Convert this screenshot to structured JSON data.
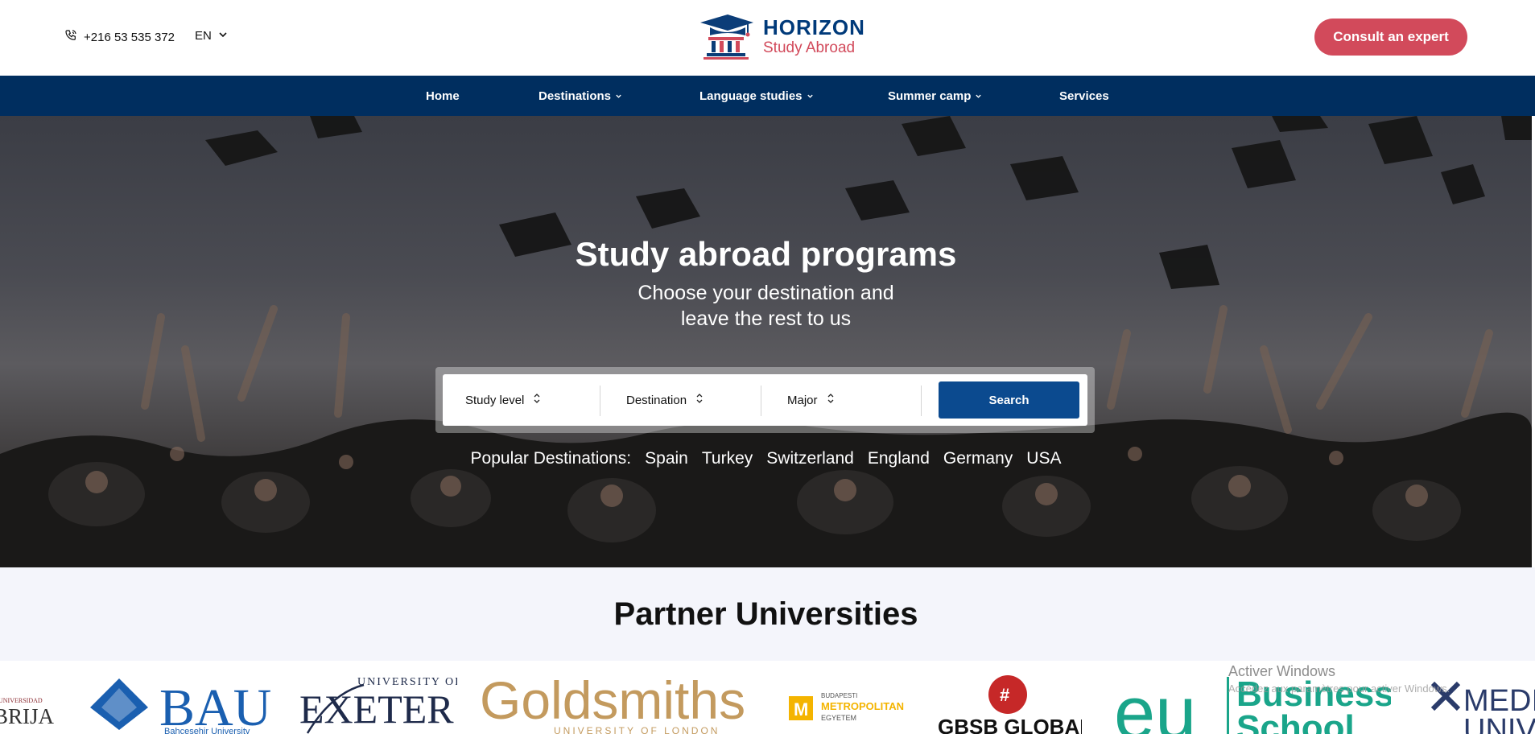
{
  "header": {
    "phone": "+216 53 535 372",
    "language": "EN",
    "logo_title": "HORIZON",
    "logo_subtitle": "Study Abroad",
    "consult_label": "Consult an expert"
  },
  "nav": {
    "items": [
      {
        "label": "Home",
        "has_dropdown": false
      },
      {
        "label": "Destinations",
        "has_dropdown": true
      },
      {
        "label": "Language studies",
        "has_dropdown": true
      },
      {
        "label": "Summer camp",
        "has_dropdown": true
      },
      {
        "label": "Services",
        "has_dropdown": false
      }
    ]
  },
  "hero": {
    "title": "Study abroad programs",
    "subtitle_line1": "Choose your destination and",
    "subtitle_line2": "leave the rest to us",
    "search": {
      "study_level": "Study level",
      "destination": "Destination",
      "major": "Major",
      "button": "Search"
    },
    "popular_label": "Popular Destinations:",
    "popular": [
      "Spain",
      "Turkey",
      "Switzerland",
      "England",
      "Germany",
      "USA"
    ]
  },
  "partners": {
    "title": "Partner Universities",
    "logos": [
      {
        "name": "nebrija-logo",
        "text": "BRIJA",
        "small": "UNIVERSIDAD"
      },
      {
        "name": "bau-logo",
        "text": "BAU",
        "small": "Bahcesehir University"
      },
      {
        "name": "exeter-logo",
        "text": "EXETER",
        "small": "UNIVERSITY OF"
      },
      {
        "name": "goldsmiths-logo",
        "text": "Goldsmiths",
        "small": "UNIVERSITY OF LONDON"
      },
      {
        "name": "budapest-metropolitan-logo",
        "text": "METROPOLITAN",
        "small": "BUDAPESTI",
        "small2": "EGYETEM"
      },
      {
        "name": "gbsb-logo",
        "text": "GBSB GLOBAL"
      },
      {
        "name": "eu-business-school-logo",
        "text": "Business",
        "text2": "School"
      },
      {
        "name": "medi-logo",
        "text": "MEDI",
        "text2": "UNIV"
      }
    ]
  },
  "overlay": {
    "activate_title": "Activer Windows",
    "activate_sub": "Accédez aux paramètres pour activer Windows."
  },
  "colors": {
    "brand_blue": "#002e5f",
    "brand_red": "#d24a5b",
    "search_blue": "#0b4a8f",
    "partners_bg": "#f4f5fb"
  }
}
